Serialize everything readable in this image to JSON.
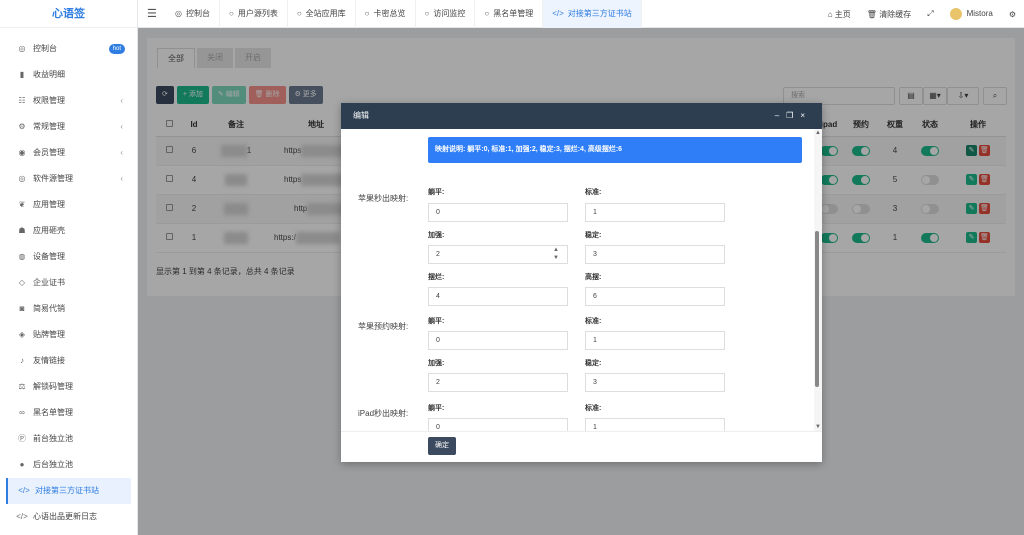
{
  "brand": "心语签",
  "sidebar": {
    "items": [
      {
        "icon": "◎",
        "label": "控制台",
        "badge": "hot",
        "arrow": ""
      },
      {
        "icon": "▮",
        "label": "收益明细",
        "badge": "",
        "arrow": ""
      },
      {
        "icon": "☷",
        "label": "权限管理",
        "badge": "",
        "arrow": "‹"
      },
      {
        "icon": "⚙",
        "label": "常规管理",
        "badge": "",
        "arrow": "‹"
      },
      {
        "icon": "◉",
        "label": "会员管理",
        "badge": "",
        "arrow": "‹"
      },
      {
        "icon": "◎",
        "label": "软件源管理",
        "badge": "",
        "arrow": "‹"
      },
      {
        "icon": "❦",
        "label": "应用管理",
        "badge": "",
        "arrow": ""
      },
      {
        "icon": "☗",
        "label": "应用砸壳",
        "badge": "",
        "arrow": ""
      },
      {
        "icon": "◍",
        "label": "设备管理",
        "badge": "",
        "arrow": ""
      },
      {
        "icon": "◇",
        "label": "企业证书",
        "badge": "",
        "arrow": ""
      },
      {
        "icon": "◙",
        "label": "简易代销",
        "badge": "",
        "arrow": ""
      },
      {
        "icon": "◈",
        "label": "贴牌管理",
        "badge": "",
        "arrow": ""
      },
      {
        "icon": "♪",
        "label": "友情链接",
        "badge": "",
        "arrow": ""
      },
      {
        "icon": "⚖",
        "label": "解锁码管理",
        "badge": "",
        "arrow": ""
      },
      {
        "icon": "∞",
        "label": "黑名单管理",
        "badge": "",
        "arrow": ""
      },
      {
        "icon": "Ⓟ",
        "label": "前台独立池",
        "badge": "",
        "arrow": ""
      },
      {
        "icon": "●",
        "label": "后台独立池",
        "badge": "",
        "arrow": ""
      },
      {
        "icon": "</>",
        "label": "对接第三方证书站",
        "badge": "",
        "arrow": ""
      },
      {
        "icon": "</>",
        "label": "心语出品更新日志",
        "badge": "",
        "arrow": ""
      }
    ]
  },
  "topbar": {
    "tabs": [
      {
        "icon": "◎",
        "label": "控制台"
      },
      {
        "icon": "○",
        "label": "用户源列表"
      },
      {
        "icon": "○",
        "label": "全站应用库"
      },
      {
        "icon": "○",
        "label": "卡密总览"
      },
      {
        "icon": "○",
        "label": "访问监控"
      },
      {
        "icon": "○",
        "label": "黑名单管理"
      },
      {
        "icon": "</>",
        "label": "对接第三方证书站"
      }
    ],
    "home": "主页",
    "clear_cache": "清除缓存",
    "username": "Mistora"
  },
  "filter_tabs": [
    "全部",
    "关闭",
    "开启"
  ],
  "toolbar": {
    "refresh": "⟳",
    "add": "+ 添加",
    "edit": "✎ 编辑",
    "delete": "🗑 删除",
    "more": "⚙ 更多"
  },
  "search": {
    "placeholder": "搜索"
  },
  "table": {
    "columns": {
      "id": "Id",
      "remark": "备注",
      "address": "地址",
      "ipad": "ipad",
      "reserve": "预约",
      "weight": "权重",
      "status": "状态",
      "ops": "操作"
    },
    "rows": [
      {
        "id": "6",
        "remark": "1",
        "address": "https",
        "ipad": true,
        "reserve": true,
        "weight": "4",
        "status": true
      },
      {
        "id": "4",
        "remark": "",
        "address": "https",
        "ipad": true,
        "reserve": true,
        "weight": "5",
        "status": false
      },
      {
        "id": "2",
        "remark": "",
        "address": "http",
        "ipad": false,
        "reserve": false,
        "weight": "3",
        "status": false
      },
      {
        "id": "1",
        "remark": "",
        "address": "https:/",
        "ipad": true,
        "reserve": true,
        "weight": "1",
        "status": true
      }
    ],
    "summary": "显示第 1 到第 4 条记录，总共 4 条记录"
  },
  "modal": {
    "title": "编辑",
    "notice": "映射说明: 躺平:0, 标准:1, 加强:2, 稳定:3, 摆烂:4, 高级摆烂:6",
    "sections": {
      "s1": "苹果秒出映射:",
      "s2": "苹果预约映射:",
      "s3": "iPad秒出映射:"
    },
    "fields": {
      "f1": {
        "label": "躺平:",
        "value": "0"
      },
      "f2": {
        "label": "标准:",
        "value": "1"
      },
      "f3": {
        "label": "加强:",
        "value": "2"
      },
      "f4": {
        "label": "稳定:",
        "value": "3"
      },
      "f5": {
        "label": "摆烂:",
        "value": "4"
      },
      "f6": {
        "label": "高摆:",
        "value": "6"
      },
      "f7": {
        "label": "躺平:",
        "value": "0"
      },
      "f8": {
        "label": "标准:",
        "value": "1"
      },
      "f9": {
        "label": "加强:",
        "value": "2"
      },
      "f10": {
        "label": "稳定:",
        "value": "3"
      },
      "f11": {
        "label": "躺平:",
        "value": "0"
      },
      "f12": {
        "label": "标准:",
        "value": "1"
      }
    },
    "confirm": "确定"
  }
}
